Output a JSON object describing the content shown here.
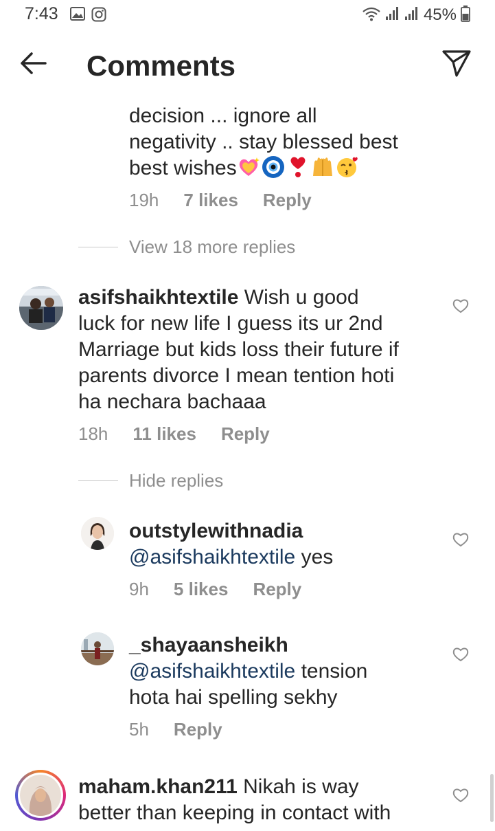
{
  "status_bar": {
    "time": "7:43",
    "battery": "45%"
  },
  "header": {
    "title": "Comments"
  },
  "comments": [
    {
      "text_top": "decision ... ignore all",
      "text_mid": "negativity .. stay blessed best",
      "text_end": "best wishes",
      "emojis": [
        "sparkling-heart-icon",
        "nazar-amulet-icon",
        "heart-exclamation-icon",
        "raised-hands-icon",
        "face-blowing-kiss-icon"
      ],
      "time": "19h",
      "likes": "7 likes",
      "reply": "Reply"
    },
    {
      "toggle": "View 18 more replies"
    },
    {
      "username": "asifshaikhtextile",
      "text_line1": " Wish u good",
      "text_line2": "luck for new life I guess its ur 2nd",
      "text_line3": "Marriage but kids loss their future if",
      "text_line4": "parents divorce I mean tention hoti",
      "text_line5": "ha nechara bachaaa",
      "time": "18h",
      "likes": "11 likes",
      "reply": "Reply"
    },
    {
      "toggle": "Hide replies"
    },
    {
      "username": "outstylewithnadia",
      "mention": "@asifshaikhtextile",
      "text": " yes",
      "time": "9h",
      "likes": "5 likes",
      "reply": "Reply"
    },
    {
      "username": "_shayaansheikh",
      "mention": "@asifshaikhtextile",
      "text_line1": " tension",
      "text_line2": "hota hai spelling sekhy",
      "time": "5h",
      "reply": "Reply"
    },
    {
      "username": "maham.khan211",
      "text_line1": " Nikah is way",
      "text_line2": "better than keeping in contact with"
    }
  ],
  "colors": {
    "meta_gray": "#8e8e8e",
    "mention_blue": "#1b3a5e",
    "text": "#262626"
  }
}
